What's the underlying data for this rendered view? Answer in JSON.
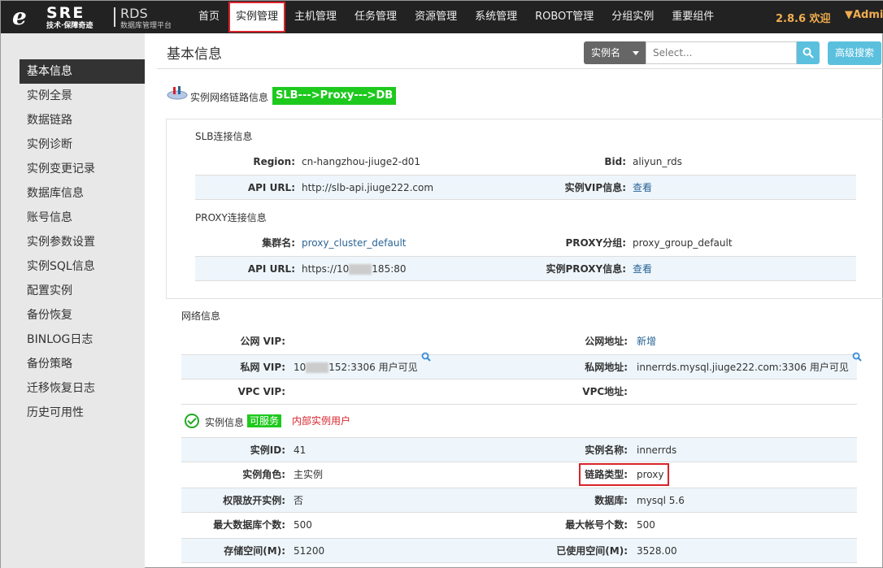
{
  "header": {
    "logo_e": "e",
    "logo_sre": "SRE",
    "logo_rds": "RDS",
    "logo_slogan": "技术·保障奇迹",
    "logo_platform": "数据库管理平台",
    "nav": [
      "首页",
      "实例管理",
      "主机管理",
      "任务管理",
      "资源管理",
      "系统管理",
      "ROBOT管理",
      "分组实例",
      "重要组件"
    ],
    "active_nav": "实例管理",
    "version": "2.8.6 欢迎",
    "user": "Admir"
  },
  "sidebar": {
    "items": [
      "基本信息",
      "实例全景",
      "数据链路",
      "实例诊断",
      "实例变更记录",
      "数据库信息",
      "账号信息",
      "实例参数设置",
      "实例SQL信息",
      "配置实例",
      "备份恢复",
      "BINLOG日志",
      "备份策略",
      "迁移恢复日志",
      "历史可用性"
    ],
    "active": "基本信息"
  },
  "page": {
    "title": "基本信息",
    "search_select": "实例名",
    "search_placeholder": "Select...",
    "advanced_search": "高级搜索"
  },
  "link_info": {
    "label": "实例网络链路信息",
    "badge": "SLB--->Proxy--->DB"
  },
  "slb": {
    "title": "SLB连接信息",
    "region_label": "Region:",
    "region": "cn-hangzhou-jiuge2-d01",
    "bid_label": "Bid:",
    "bid": "aliyun_rds",
    "api_label": "API URL:",
    "api": "http://slb-api.jiuge222.com",
    "vip_label": "实例VIP信息:",
    "vip_link": "查看"
  },
  "proxy": {
    "title": "PROXY连接信息",
    "cluster_label": "集群名:",
    "cluster": "proxy_cluster_default",
    "group_label": "PROXY分组:",
    "group": "proxy_group_default",
    "api_label": "API URL:",
    "api_prefix": "https://10",
    "api_suffix": "185:80",
    "info_label": "实例PROXY信息:",
    "info_link": "查看"
  },
  "network": {
    "title": "网络信息",
    "public_vip_label": "公网 VIP:",
    "public_vip": "",
    "public_addr_label": "公网地址:",
    "public_addr": "新增",
    "private_vip_label": "私网 VIP:",
    "private_vip_prefix": "10",
    "private_vip_suffix": "152:3306 用户可见",
    "private_addr_label": "私网地址:",
    "private_addr": "innerrds.mysql.jiuge222.com:3306 用户可见",
    "vpc_vip_label": "VPC VIP:",
    "vpc_addr_label": "VPC地址:"
  },
  "instance": {
    "title": "实例信息",
    "status": "可服务",
    "user_type": "内部实例用户",
    "rows": [
      {
        "l1": "实例ID:",
        "v1": "41",
        "l2": "实例名称:",
        "v2": "innerrds"
      },
      {
        "l1": "实例角色:",
        "v1": "主实例",
        "l2": "链路类型:",
        "v2": "proxy"
      },
      {
        "l1": "权限放开实例:",
        "v1": "否",
        "l2": "数据库:",
        "v2": "mysql 5.6"
      },
      {
        "l1": "最大数据库个数:",
        "v1": "500",
        "l2": "最大帐号个数:",
        "v2": "500"
      },
      {
        "l1": "存储空间(M):",
        "v1": "51200",
        "l2": "已使用空间(M):",
        "v2": "3528.00"
      }
    ]
  }
}
